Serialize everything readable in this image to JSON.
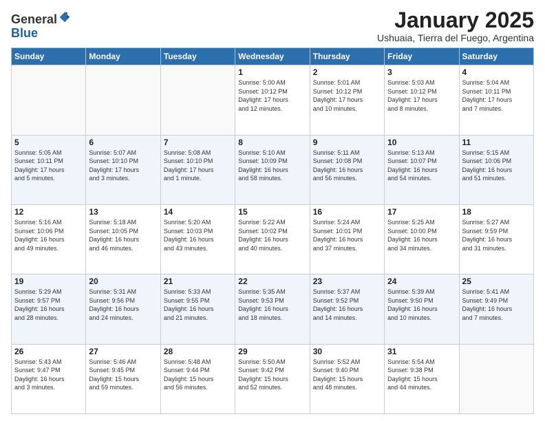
{
  "header": {
    "logo_general": "General",
    "logo_blue": "Blue",
    "month": "January 2025",
    "location": "Ushuaia, Tierra del Fuego, Argentina"
  },
  "weekdays": [
    "Sunday",
    "Monday",
    "Tuesday",
    "Wednesday",
    "Thursday",
    "Friday",
    "Saturday"
  ],
  "weeks": [
    [
      {
        "day": "",
        "info": ""
      },
      {
        "day": "",
        "info": ""
      },
      {
        "day": "",
        "info": ""
      },
      {
        "day": "1",
        "info": "Sunrise: 5:00 AM\nSunset: 10:12 PM\nDaylight: 17 hours\nand 12 minutes."
      },
      {
        "day": "2",
        "info": "Sunrise: 5:01 AM\nSunset: 10:12 PM\nDaylight: 17 hours\nand 10 minutes."
      },
      {
        "day": "3",
        "info": "Sunrise: 5:03 AM\nSunset: 10:12 PM\nDaylight: 17 hours\nand 8 minutes."
      },
      {
        "day": "4",
        "info": "Sunrise: 5:04 AM\nSunset: 10:11 PM\nDaylight: 17 hours\nand 7 minutes."
      }
    ],
    [
      {
        "day": "5",
        "info": "Sunrise: 5:05 AM\nSunset: 10:11 PM\nDaylight: 17 hours\nand 5 minutes."
      },
      {
        "day": "6",
        "info": "Sunrise: 5:07 AM\nSunset: 10:10 PM\nDaylight: 17 hours\nand 3 minutes."
      },
      {
        "day": "7",
        "info": "Sunrise: 5:08 AM\nSunset: 10:10 PM\nDaylight: 17 hours\nand 1 minute."
      },
      {
        "day": "8",
        "info": "Sunrise: 5:10 AM\nSunset: 10:09 PM\nDaylight: 16 hours\nand 58 minutes."
      },
      {
        "day": "9",
        "info": "Sunrise: 5:11 AM\nSunset: 10:08 PM\nDaylight: 16 hours\nand 56 minutes."
      },
      {
        "day": "10",
        "info": "Sunrise: 5:13 AM\nSunset: 10:07 PM\nDaylight: 16 hours\nand 54 minutes."
      },
      {
        "day": "11",
        "info": "Sunrise: 5:15 AM\nSunset: 10:06 PM\nDaylight: 16 hours\nand 51 minutes."
      }
    ],
    [
      {
        "day": "12",
        "info": "Sunrise: 5:16 AM\nSunset: 10:06 PM\nDaylight: 16 hours\nand 49 minutes."
      },
      {
        "day": "13",
        "info": "Sunrise: 5:18 AM\nSunset: 10:05 PM\nDaylight: 16 hours\nand 46 minutes."
      },
      {
        "day": "14",
        "info": "Sunrise: 5:20 AM\nSunset: 10:03 PM\nDaylight: 16 hours\nand 43 minutes."
      },
      {
        "day": "15",
        "info": "Sunrise: 5:22 AM\nSunset: 10:02 PM\nDaylight: 16 hours\nand 40 minutes."
      },
      {
        "day": "16",
        "info": "Sunrise: 5:24 AM\nSunset: 10:01 PM\nDaylight: 16 hours\nand 37 minutes."
      },
      {
        "day": "17",
        "info": "Sunrise: 5:25 AM\nSunset: 10:00 PM\nDaylight: 16 hours\nand 34 minutes."
      },
      {
        "day": "18",
        "info": "Sunrise: 5:27 AM\nSunset: 9:59 PM\nDaylight: 16 hours\nand 31 minutes."
      }
    ],
    [
      {
        "day": "19",
        "info": "Sunrise: 5:29 AM\nSunset: 9:57 PM\nDaylight: 16 hours\nand 28 minutes."
      },
      {
        "day": "20",
        "info": "Sunrise: 5:31 AM\nSunset: 9:56 PM\nDaylight: 16 hours\nand 24 minutes."
      },
      {
        "day": "21",
        "info": "Sunrise: 5:33 AM\nSunset: 9:55 PM\nDaylight: 16 hours\nand 21 minutes."
      },
      {
        "day": "22",
        "info": "Sunrise: 5:35 AM\nSunset: 9:53 PM\nDaylight: 16 hours\nand 18 minutes."
      },
      {
        "day": "23",
        "info": "Sunrise: 5:37 AM\nSunset: 9:52 PM\nDaylight: 16 hours\nand 14 minutes."
      },
      {
        "day": "24",
        "info": "Sunrise: 5:39 AM\nSunset: 9:50 PM\nDaylight: 16 hours\nand 10 minutes."
      },
      {
        "day": "25",
        "info": "Sunrise: 5:41 AM\nSunset: 9:49 PM\nDaylight: 16 hours\nand 7 minutes."
      }
    ],
    [
      {
        "day": "26",
        "info": "Sunrise: 5:43 AM\nSunset: 9:47 PM\nDaylight: 16 hours\nand 3 minutes."
      },
      {
        "day": "27",
        "info": "Sunrise: 5:46 AM\nSunset: 9:45 PM\nDaylight: 15 hours\nand 59 minutes."
      },
      {
        "day": "28",
        "info": "Sunrise: 5:48 AM\nSunset: 9:44 PM\nDaylight: 15 hours\nand 56 minutes."
      },
      {
        "day": "29",
        "info": "Sunrise: 5:50 AM\nSunset: 9:42 PM\nDaylight: 15 hours\nand 52 minutes."
      },
      {
        "day": "30",
        "info": "Sunrise: 5:52 AM\nSunset: 9:40 PM\nDaylight: 15 hours\nand 48 minutes."
      },
      {
        "day": "31",
        "info": "Sunrise: 5:54 AM\nSunset: 9:38 PM\nDaylight: 15 hours\nand 44 minutes."
      },
      {
        "day": "",
        "info": ""
      }
    ]
  ]
}
